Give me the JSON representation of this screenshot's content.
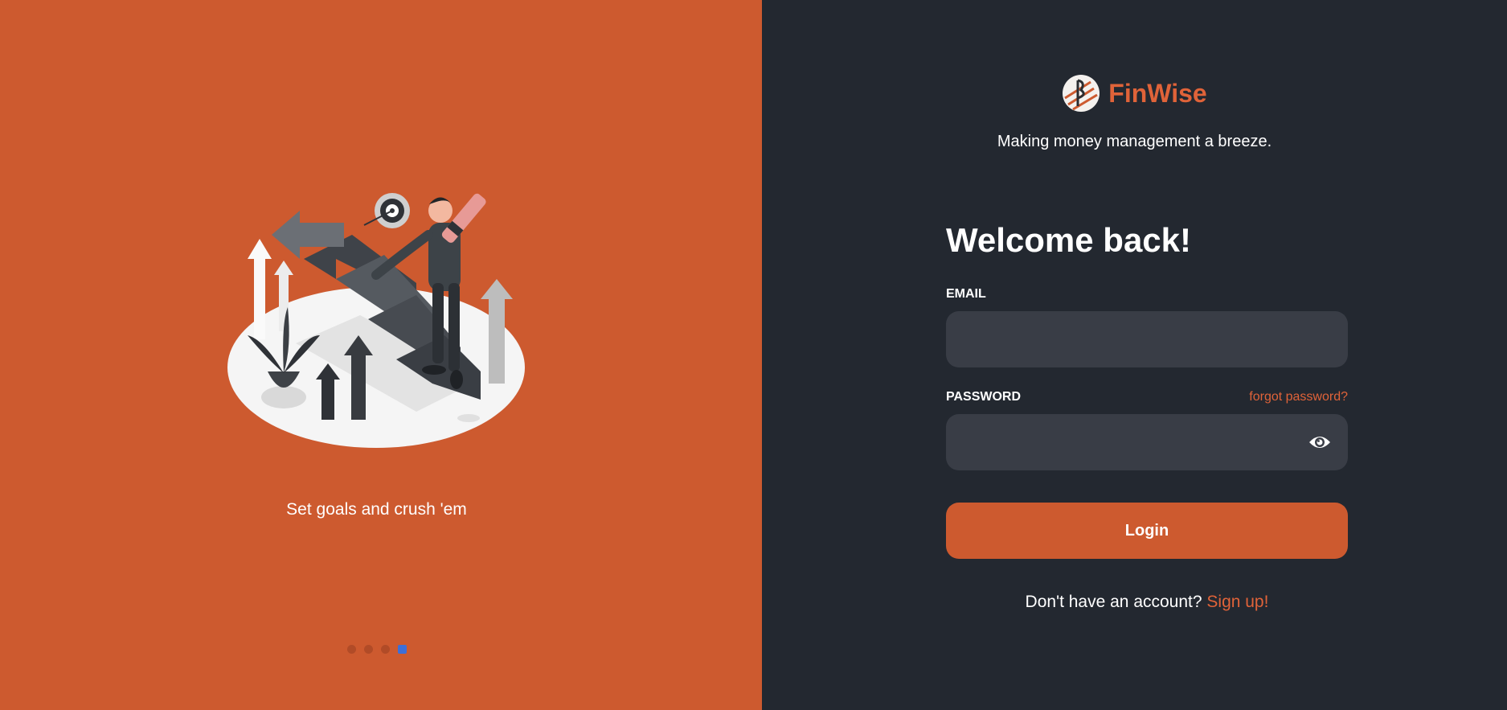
{
  "carousel": {
    "caption": "Set goals and crush 'em",
    "dots": [
      false,
      false,
      false,
      true
    ]
  },
  "brand": {
    "name": "FinWise",
    "tagline": "Making money management a breeze."
  },
  "form": {
    "heading": "Welcome back!",
    "email_label": "EMAIL",
    "email_value": "",
    "password_label": "PASSWORD",
    "forgot_label": "forgot password?",
    "password_value": "",
    "login_label": "Login",
    "signup_prompt": "Don't have an account?",
    "signup_label": "Sign up!"
  },
  "colors": {
    "accent": "#cd5a2f",
    "panel": "#232830",
    "input_bg": "#393d46",
    "link": "#e06339",
    "active_dot": "#3d6fd8"
  },
  "icons": {
    "logo": "finwise-logo-icon",
    "password_toggle": "eye-icon"
  }
}
